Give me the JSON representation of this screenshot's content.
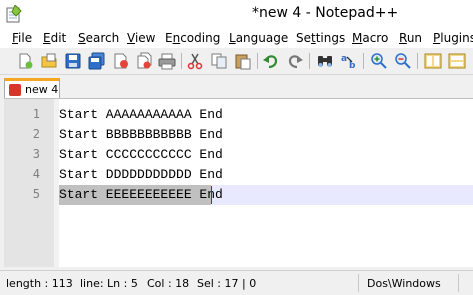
{
  "window": {
    "title": "*new  4 - Notepad++"
  },
  "menubar": {
    "items": [
      {
        "pre": "",
        "ul": "F",
        "post": "ile"
      },
      {
        "pre": "",
        "ul": "E",
        "post": "dit"
      },
      {
        "pre": "",
        "ul": "S",
        "post": "earch"
      },
      {
        "pre": "",
        "ul": "V",
        "post": "iew"
      },
      {
        "pre": "E",
        "ul": "n",
        "post": "coding"
      },
      {
        "pre": "",
        "ul": "L",
        "post": "anguage"
      },
      {
        "pre": "Se",
        "ul": "t",
        "post": "tings"
      },
      {
        "pre": "",
        "ul": "M",
        "post": "acro"
      },
      {
        "pre": "",
        "ul": "R",
        "post": "un"
      },
      {
        "pre": "",
        "ul": "P",
        "post": "lugins"
      }
    ]
  },
  "toolbar": {
    "icons": [
      "new-file",
      "open-file",
      "save",
      "save-all",
      "close",
      "close-all",
      "print",
      "cut",
      "copy",
      "paste",
      "undo",
      "redo",
      "find",
      "replace",
      "zoom-in",
      "zoom-out",
      "sync-vertical",
      "sync-horizontal"
    ]
  },
  "tab": {
    "label": "new  4"
  },
  "editor": {
    "line_numbers": [
      "1",
      "2",
      "3",
      "4",
      "5"
    ],
    "lines": [
      "Start AAAAAAAAAAA End",
      "Start BBBBBBBBBBB End",
      "Start CCCCCCCCCCC End",
      "Start DDDDDDDDDDD End",
      "Start EEEEEEEEEEE End"
    ]
  },
  "status": {
    "length": "length : 113",
    "lines": "line: Ln : 5",
    "col": "Col : 18",
    "sel": "Sel : 17 | 0",
    "eol": "Dos\\Windows"
  },
  "colors": {
    "tab_accent": "#f5a623",
    "current_line": "#e8e8ff",
    "selection": "#c0c0c0",
    "caret": "#8000ff"
  }
}
